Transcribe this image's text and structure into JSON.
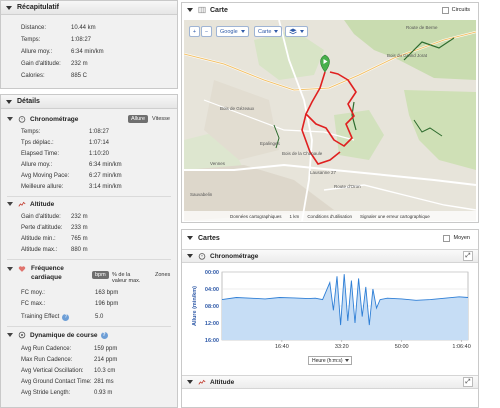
{
  "summary": {
    "title": "Récapitulatif",
    "rows": [
      {
        "label": "Distance:",
        "value": "10.44 km"
      },
      {
        "label": "Temps:",
        "value": "1:08:27"
      },
      {
        "label": "Allure moy.:",
        "value": "6:34 min/km"
      },
      {
        "label": "Gain d'altitude:",
        "value": "232 m"
      },
      {
        "label": "Calories:",
        "value": "885 C"
      }
    ]
  },
  "details": {
    "title": "Détails",
    "chrono": {
      "title": "Chronométrage",
      "toggle_on": "Allure",
      "toggle_off": "Vitesse",
      "rows": [
        {
          "label": "Temps:",
          "value": "1:08:27"
        },
        {
          "label": "Tps déplac.:",
          "value": "1:07:14"
        },
        {
          "label": "Elapsed Time:",
          "value": "1:10:20"
        },
        {
          "label": "Allure moy.:",
          "value": "6:34 min/km"
        },
        {
          "label": "Avg Moving Pace:",
          "value": "6:27 min/km"
        },
        {
          "label": "Meilleure allure:",
          "value": "3:14 min/km"
        }
      ]
    },
    "altitude": {
      "title": "Altitude",
      "rows": [
        {
          "label": "Gain d'altitude:",
          "value": "232 m"
        },
        {
          "label": "Perte d'altitude:",
          "value": "233 m"
        },
        {
          "label": "Altitude min.:",
          "value": "765 m"
        },
        {
          "label": "Altitude max.:",
          "value": "880 m"
        }
      ]
    },
    "heart": {
      "title": "Fréquence cardiaque",
      "toggle_bpm": "bpm",
      "toggle_pct": "% de la valeur max.",
      "toggle_zones": "Zones",
      "rows": [
        {
          "label": "FC moy.:",
          "value": "163 bpm"
        },
        {
          "label": "FC max.:",
          "value": "196 bpm"
        },
        {
          "label": "Training Effect",
          "value": "5.0"
        }
      ]
    },
    "dynamics": {
      "title": "Dynamique de course",
      "rows": [
        {
          "label": "Avg Run Cadence:",
          "value": "159 ppm"
        },
        {
          "label": "Max Run Cadence:",
          "value": "214 ppm"
        },
        {
          "label": "Avg Vertical Oscillation:",
          "value": "10.3 cm"
        },
        {
          "label": "Avg Ground Contact Time:",
          "value": "281 ms"
        },
        {
          "label": "Avg Stride Length:",
          "value": "0.93 m"
        }
      ]
    }
  },
  "map": {
    "title": "Carte",
    "circuits_label": "Circuits",
    "zoom_in": "+",
    "zoom_out": "−",
    "provider": "Google",
    "layer": "Carte",
    "footer": {
      "data": "Données cartographiques",
      "scale": "1 km",
      "terms": "Conditions d'utilisation",
      "report": "Signaler une erreur cartographique"
    },
    "places": [
      "Bois du Grand Jorat",
      "Bois de Gézeaux",
      "Epalinges",
      "Bois de la Chanaule",
      "Vennes",
      "Route de Berne",
      "Lausanne 27",
      "Route d'Oron",
      "Sauvabelin"
    ]
  },
  "charts": {
    "title": "Cartes",
    "moyen_label": "Moyen",
    "chrono_title": "Chronométrage",
    "altitude_title": "Altitude",
    "xaxis_select": "Heure (h:m:s)",
    "colors": {
      "line": "#2f7fd6",
      "fill": "#c6ddf5"
    }
  },
  "chart_data": {
    "type": "area",
    "title": "",
    "xlabel": "",
    "ylabel": "Allure (min/km)",
    "xlim": [
      "0:00",
      "1:08:27"
    ],
    "x_ticks": [
      "16:40",
      "33:20",
      "50:00",
      "1:06:40"
    ],
    "y_ticks": [
      "00:00",
      "04:00",
      "08:00",
      "12:00",
      "16:00"
    ],
    "y_inverted": true,
    "series": [
      {
        "x": [
          "0:00",
          "4:00",
          "8:00",
          "12:00",
          "16:00",
          "20:00",
          "24:00",
          "26:00",
          "28:00",
          "30:00",
          "31:00",
          "32:00",
          "33:00",
          "34:00",
          "35:00",
          "36:00",
          "37:00",
          "38:00",
          "39:00",
          "40:00",
          "41:00",
          "42:00",
          "43:00",
          "44:00",
          "46:00",
          "50:00",
          "54:00",
          "58:00",
          "62:00",
          "66:00",
          "68:27"
        ],
        "y": [
          "6:30",
          "6:00",
          "6:10",
          "6:20",
          "6:00",
          "6:05",
          "6:15",
          "6:10",
          "6:30",
          "2:30",
          "9:00",
          "1:00",
          "12:30",
          "0:30",
          "11:30",
          "2:00",
          "12:00",
          "1:30",
          "10:30",
          "3:30",
          "12:30",
          "4:00",
          "8:30",
          "6:30",
          "6:10",
          "6:20",
          "6:40",
          "6:30",
          "6:10",
          "5:50",
          "6:00"
        ]
      }
    ]
  }
}
